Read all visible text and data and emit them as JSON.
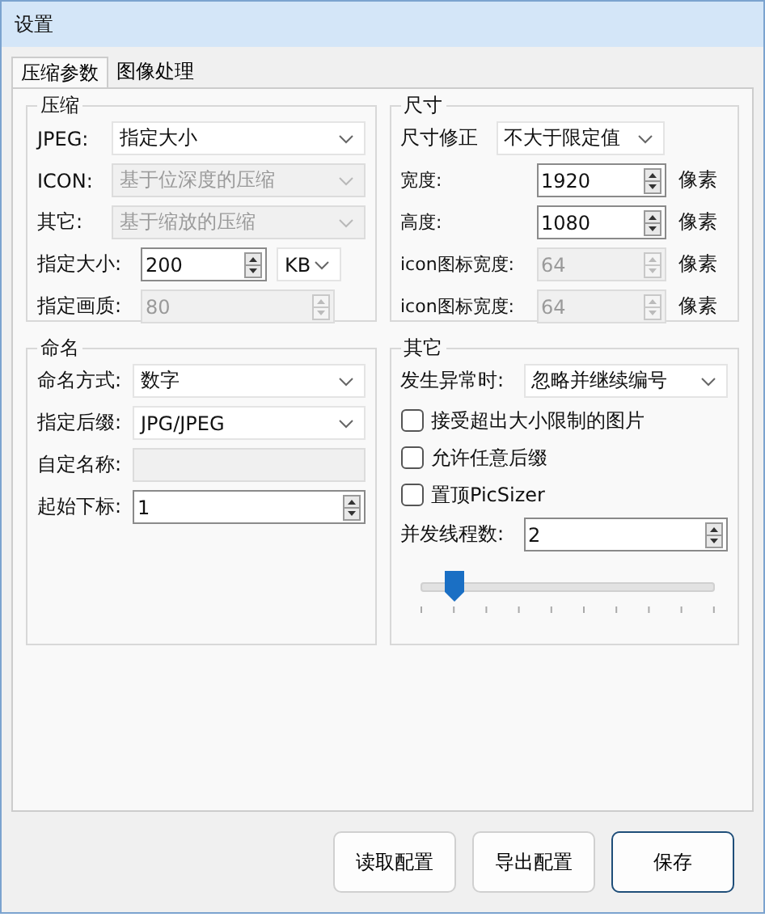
{
  "window": {
    "title": "设置"
  },
  "tabs": [
    {
      "label": "压缩参数",
      "selected": true
    },
    {
      "label": "图像处理",
      "selected": false
    }
  ],
  "columns": [
    {
      "groups": [
        {
          "title": "压缩",
          "rows": [
            {
              "kind": "select",
              "label": "JPEG:",
              "value": "指定大小",
              "disabled": false
            },
            {
              "kind": "select",
              "label": "ICON:",
              "value": "基于位深度的压缩",
              "disabled": true
            },
            {
              "kind": "select",
              "label": "其它:",
              "value": "基于缩放的压缩",
              "disabled": true
            },
            {
              "kind": "spin",
              "label": "指定大小:",
              "value": "200",
              "unit_select": "KB",
              "disabled": false
            },
            {
              "kind": "spin",
              "label": "指定画质:",
              "value": "80",
              "disabled": true
            }
          ]
        },
        {
          "title": "命名",
          "rows": [
            {
              "kind": "select",
              "label": "命名方式:",
              "value": "数字",
              "disabled": false
            },
            {
              "kind": "select",
              "label": "指定后缀:",
              "value": "JPG/JPEG",
              "disabled": false
            },
            {
              "kind": "text",
              "label": "自定名称:",
              "disabled": true
            },
            {
              "kind": "spin",
              "label": "起始下标:",
              "value": "1",
              "disabled": false
            }
          ]
        }
      ]
    },
    {
      "groups": [
        {
          "title": "尺寸",
          "rows": [
            {
              "kind": "select",
              "label": "尺寸修正",
              "value": "不大于限定值",
              "disabled": false
            },
            {
              "kind": "spin",
              "label": "宽度:",
              "value": "1920",
              "unit": "像素",
              "disabled": false
            },
            {
              "kind": "spin",
              "label": "高度:",
              "value": "1080",
              "unit": "像素",
              "disabled": false
            },
            {
              "kind": "spin",
              "label": "icon图标宽度:",
              "value": "64",
              "unit": "像素",
              "disabled": true
            },
            {
              "kind": "spin",
              "label": "icon图标宽度:",
              "value": "64",
              "unit": "像素",
              "disabled": true
            }
          ]
        },
        {
          "title": "其它",
          "rows": [
            {
              "kind": "select",
              "label": "发生异常时:",
              "value": "忽略并继续编号",
              "disabled": false
            },
            {
              "kind": "check",
              "label": "接受超出大小限制的图片",
              "checked": false
            },
            {
              "kind": "check",
              "label": "允许任意后缀",
              "checked": false
            },
            {
              "kind": "check",
              "label": "置顶PicSizer",
              "checked": false
            },
            {
              "kind": "spin",
              "label": "并发线程数:",
              "value": "2",
              "disabled": false
            },
            {
              "kind": "slider",
              "level": 0.11
            }
          ]
        }
      ]
    }
  ],
  "buttons": [
    {
      "label": "读取配置",
      "default": false
    },
    {
      "label": "导出配置",
      "default": false
    },
    {
      "label": "保存",
      "default": true
    }
  ]
}
